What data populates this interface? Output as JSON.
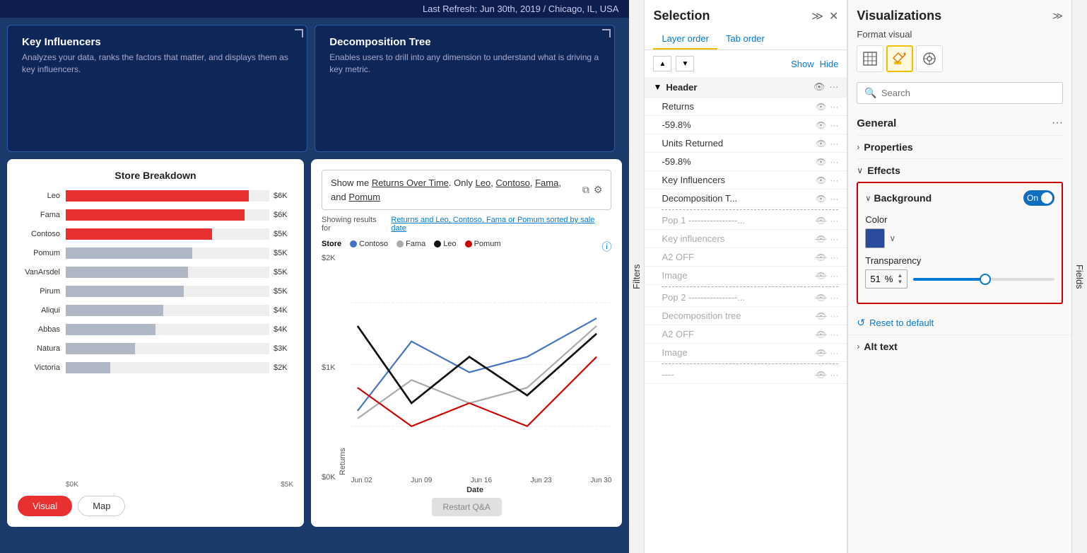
{
  "topbar": {
    "refresh_text": "Last Refresh: Jun 30th, 2019 / Chicago, IL, USA"
  },
  "visual_cards": [
    {
      "title": "Key Influencers",
      "desc": "Analyzes your data, ranks the factors that matter, and displays them as key influencers."
    },
    {
      "title": "Decomposition Tree",
      "desc": "Enables users to drill into any dimension to understand what is driving a key metric."
    }
  ],
  "store_breakdown": {
    "title": "Store Breakdown",
    "bars": [
      {
        "label": "Leo",
        "value": "$6K",
        "pct": 90,
        "red": true
      },
      {
        "label": "Fama",
        "value": "$6K",
        "pct": 88,
        "red": true
      },
      {
        "label": "Contoso",
        "value": "$5K",
        "pct": 72,
        "red": true
      },
      {
        "label": "Pomum",
        "value": "$5K",
        "pct": 62,
        "red": false
      },
      {
        "label": "VanArsdel",
        "value": "$5K",
        "pct": 60,
        "red": false
      },
      {
        "label": "Pirum",
        "value": "$5K",
        "pct": 58,
        "red": false
      },
      {
        "label": "Aliqui",
        "value": "$4K",
        "pct": 48,
        "red": false
      },
      {
        "label": "Abbas",
        "value": "$4K",
        "pct": 44,
        "red": false
      },
      {
        "label": "Natura",
        "value": "$3K",
        "pct": 34,
        "red": false
      },
      {
        "label": "Victoria",
        "value": "$2K",
        "pct": 22,
        "red": false
      }
    ],
    "axis_min": "$0K",
    "axis_max": "$5K",
    "tabs": [
      "Visual",
      "Map"
    ]
  },
  "qa_chart": {
    "input_text": "Show me Returns Over Time. Only Leo, Contoso, Fama, and Pomum",
    "showing_for_label": "Showing results for",
    "showing_link": "Returns and Leo, Contoso, Fama or Pomum sorted by sale date",
    "legend_title": "Store",
    "legend_items": [
      {
        "label": "Contoso",
        "color": "#4472c4"
      },
      {
        "label": "Fama",
        "color": "#aaa"
      },
      {
        "label": "Leo",
        "color": "#111"
      },
      {
        "label": "Pomum",
        "color": "#c00"
      }
    ],
    "y_axis": "Returns",
    "x_labels": [
      "Jun 02",
      "Jun 09",
      "Jun 16",
      "Jun 23",
      "Jun 30"
    ],
    "y_labels": [
      "$2K",
      "$1K",
      "$0K"
    ],
    "restart_btn": "Restart Q&A"
  },
  "filters": {
    "label": "Filters"
  },
  "selection": {
    "title": "Selection",
    "tabs": [
      "Layer order",
      "Tab order"
    ],
    "active_tab": 0,
    "show_label": "Show",
    "hide_label": "Hide",
    "sections": [
      {
        "title": "Header",
        "items": [
          {
            "label": "Returns",
            "hidden": false
          },
          {
            "label": "-59.8%",
            "hidden": false
          },
          {
            "label": "Units Returned",
            "hidden": false
          },
          {
            "label": "-59.8%",
            "hidden": false
          },
          {
            "label": "Key Influencers",
            "hidden": false
          },
          {
            "label": "Decomposition T...",
            "hidden": false
          }
        ]
      }
    ],
    "dashed_items": [
      {
        "label": "Pop 1 ----------------...",
        "hidden": true
      },
      {
        "label": "Key influencers",
        "hidden": true
      },
      {
        "label": "A2 OFF",
        "hidden": true
      },
      {
        "label": "Image",
        "hidden": true
      },
      {
        "label": "Pop 2 ----------------...",
        "hidden": true
      },
      {
        "label": "Decomposition tree",
        "hidden": true
      },
      {
        "label": "A2 OFF",
        "hidden": true
      },
      {
        "label": "Image",
        "hidden": true
      },
      {
        "label": "----",
        "hidden": true
      }
    ]
  },
  "visualizations": {
    "title": "Visualizations",
    "format_visual_label": "Format visual",
    "icons": [
      {
        "name": "table-icon",
        "symbol": "▦",
        "active": false
      },
      {
        "name": "paint-icon",
        "symbol": "🖌",
        "active": true
      },
      {
        "name": "analytics-icon",
        "symbol": "◎",
        "active": false
      }
    ],
    "search": {
      "placeholder": "Search",
      "value": ""
    },
    "general_label": "General",
    "sections": [
      {
        "title": "Properties",
        "collapsed": true
      },
      {
        "title": "Effects",
        "collapsed": false
      }
    ],
    "effects": {
      "background": {
        "label": "Background",
        "toggle_on": true,
        "toggle_label": "On"
      },
      "color": {
        "label": "Color",
        "swatch": "#2a4a9e"
      },
      "transparency": {
        "label": "Transparency",
        "value": "51",
        "pct": "%",
        "slider_pct": 49
      }
    },
    "reset_label": "Reset to default",
    "alt_text_label": "Alt text"
  },
  "fields": {
    "label": "Fields"
  }
}
